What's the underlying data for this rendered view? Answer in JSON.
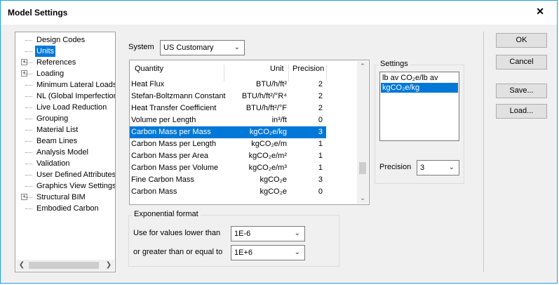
{
  "window": {
    "title": "Model Settings",
    "close_label": "✕"
  },
  "tree": {
    "items": [
      {
        "label": "Design Codes",
        "expandable": false,
        "selected": false
      },
      {
        "label": "Units",
        "expandable": false,
        "selected": true
      },
      {
        "label": "References",
        "expandable": true,
        "selected": false
      },
      {
        "label": "Loading",
        "expandable": true,
        "selected": false
      },
      {
        "label": "Minimum Lateral Loads",
        "expandable": false,
        "selected": false
      },
      {
        "label": "NL (Global Imperfections)",
        "expandable": false,
        "selected": false
      },
      {
        "label": "Live Load Reduction",
        "expandable": false,
        "selected": false
      },
      {
        "label": "Grouping",
        "expandable": false,
        "selected": false
      },
      {
        "label": "Material List",
        "expandable": false,
        "selected": false
      },
      {
        "label": "Beam Lines",
        "expandable": false,
        "selected": false
      },
      {
        "label": "Analysis Model",
        "expandable": false,
        "selected": false
      },
      {
        "label": "Validation",
        "expandable": false,
        "selected": false
      },
      {
        "label": "User Defined Attributes",
        "expandable": false,
        "selected": false
      },
      {
        "label": "Graphics View Settings",
        "expandable": false,
        "selected": false
      },
      {
        "label": "Structural BIM",
        "expandable": true,
        "selected": false
      },
      {
        "label": "Embodied Carbon",
        "expandable": false,
        "selected": false
      }
    ]
  },
  "system": {
    "label": "System",
    "value": "US Customary"
  },
  "table": {
    "headers": {
      "quantity": "Quantity",
      "unit": "Unit",
      "precision": "Precision"
    },
    "rows": [
      {
        "quantity": "Heat Flux",
        "unit": "BTU/h/ft²",
        "precision": "2",
        "selected": false
      },
      {
        "quantity": "Stefan-Boltzmann Constant",
        "unit": "BTU/h/ft²/°R⁴",
        "precision": "2",
        "selected": false
      },
      {
        "quantity": "Heat Transfer Coefficient",
        "unit": "BTU/h/ft²/°F",
        "precision": "2",
        "selected": false
      },
      {
        "quantity": "Volume per Length",
        "unit": "in³/ft",
        "precision": "0",
        "selected": false
      },
      {
        "quantity": "Carbon Mass per Mass",
        "unit": "kgCO₂e/kg",
        "precision": "3",
        "selected": true
      },
      {
        "quantity": "Carbon Mass per Length",
        "unit": "kgCO₂e/m",
        "precision": "1",
        "selected": false
      },
      {
        "quantity": "Carbon Mass per Area",
        "unit": "kgCO₂e/m²",
        "precision": "1",
        "selected": false
      },
      {
        "quantity": "Carbon Mass per Volume",
        "unit": "kgCO₂e/m³",
        "precision": "1",
        "selected": false
      },
      {
        "quantity": "Fine Carbon Mass",
        "unit": "kgCO₂e",
        "precision": "3",
        "selected": false
      },
      {
        "quantity": "Carbon Mass",
        "unit": "kgCO₂e",
        "precision": "0",
        "selected": false
      }
    ]
  },
  "exponential": {
    "title": "Exponential format",
    "lower_label": "Use for values lower than",
    "lower_value": "1E-6",
    "upper_label": "or greater than or equal to",
    "upper_value": "1E+6"
  },
  "settings": {
    "title": "Settings",
    "options": [
      {
        "label": "lb av CO₂e/lb av",
        "selected": false
      },
      {
        "label": "kgCO₂e/kg",
        "selected": true
      }
    ],
    "precision_label": "Precision",
    "precision_value": "3"
  },
  "buttons": {
    "ok": "OK",
    "cancel": "Cancel",
    "save": "Save...",
    "load": "Load..."
  }
}
